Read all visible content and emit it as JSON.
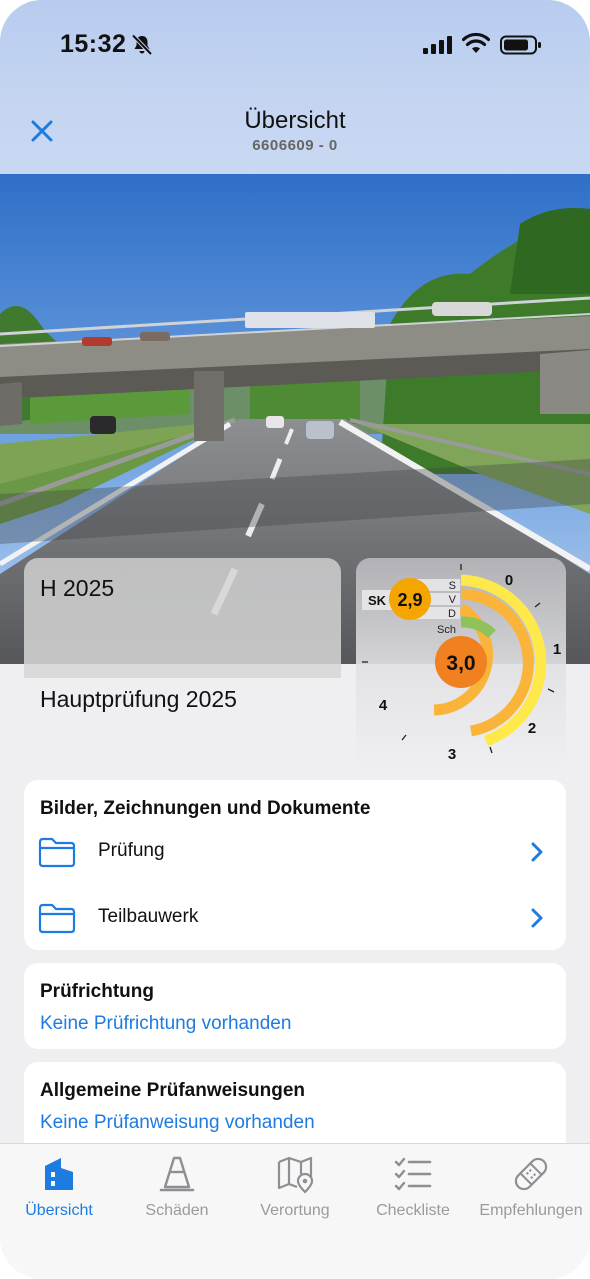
{
  "status_bar": {
    "time": "15:32"
  },
  "nav": {
    "title": "Übersicht",
    "subtitle": "6606609 - 0"
  },
  "inspection": {
    "code": "H 2025",
    "name": "Hauptprüfung 2025"
  },
  "gauge": {
    "sk_label": "SK",
    "sk_value": "2,9",
    "main_value": "3,0",
    "ring_labels": [
      "S",
      "V",
      "D",
      "Sch"
    ],
    "scale": [
      "0",
      "1",
      "2",
      "3",
      "4"
    ],
    "colors": {
      "sk": "#f5a500",
      "main": "#f08020",
      "ring_yellow": "#ffe94a",
      "ring_orange": "#fbb43a",
      "ring_green": "#8fc25a"
    }
  },
  "documents": {
    "title": "Bilder, Zeichnungen und Dokumente",
    "items": [
      {
        "label": "Prüfung"
      },
      {
        "label": "Teilbauwerk"
      }
    ]
  },
  "pruefrichtung": {
    "title": "Prüfrichtung",
    "link": "Keine Prüfrichtung vorhanden"
  },
  "pruefanweisungen": {
    "title": "Allgemeine Prüfanweisungen",
    "link": "Keine Prüfanweisung vorhanden"
  },
  "tabs": [
    {
      "label": "Übersicht",
      "icon": "building-icon",
      "active": true
    },
    {
      "label": "Schäden",
      "icon": "traffic-cone-icon",
      "active": false
    },
    {
      "label": "Verortung",
      "icon": "map-pin-icon",
      "active": false
    },
    {
      "label": "Checkliste",
      "icon": "checklist-icon",
      "active": false
    },
    {
      "label": "Empfehlungen",
      "icon": "bandage-icon",
      "active": false
    }
  ],
  "accent_color": "#1e7be0"
}
